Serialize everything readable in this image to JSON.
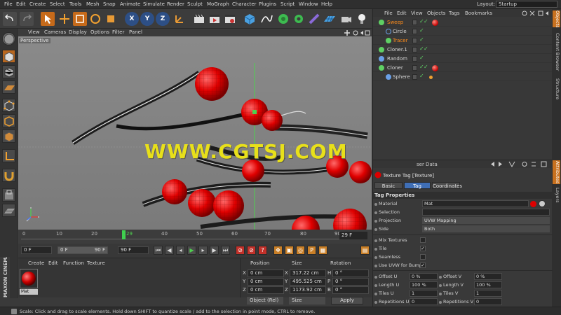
{
  "menubar": {
    "items": [
      "File",
      "Edit",
      "Create",
      "Select",
      "Tools",
      "Mesh",
      "Snap",
      "Animate",
      "Simulate",
      "Render",
      "Sculpt",
      "MoGraph",
      "Character",
      "Plugins",
      "Script",
      "Window",
      "Help"
    ],
    "layout_label": "Layout:",
    "layout_value": "Startup"
  },
  "toolbar": {
    "axis_x": "X",
    "axis_y": "Y",
    "axis_z": "Z"
  },
  "viewport": {
    "menu": [
      "View",
      "Cameras",
      "Display",
      "Options",
      "Filter",
      "Panel"
    ],
    "label": "Perspective",
    "watermark": "WWW.CGTSJ.COM"
  },
  "timeline": {
    "ticks": [
      "0",
      "10",
      "20",
      "30",
      "40",
      "50",
      "60",
      "70",
      "80",
      "90"
    ],
    "current": "29",
    "end_frame": "29 F"
  },
  "transport": {
    "start": "0 F",
    "min": "0 F",
    "max": "90 F",
    "end": "90 F"
  },
  "material_manager": {
    "menu": [
      "Create",
      "Edit",
      "Function",
      "Texture"
    ],
    "material_name": "Mat"
  },
  "maxon_logo": "MAXON CINEMA4D",
  "coordinates": {
    "headers": [
      "Position",
      "Size",
      "Rotation"
    ],
    "rows": [
      {
        "axis": "X",
        "pos": "0 cm",
        "size_axis": "X",
        "size": "317.22 cm",
        "rot_axis": "H",
        "rot": "0 °"
      },
      {
        "axis": "Y",
        "pos": "0 cm",
        "size_axis": "Y",
        "size": "495.525 cm",
        "rot_axis": "P",
        "rot": "0 °"
      },
      {
        "axis": "Z",
        "pos": "0 cm",
        "size_axis": "Z",
        "size": "1173.92 cm",
        "rot_axis": "B",
        "rot": "0 °"
      }
    ],
    "mode": "Object (Rel)",
    "size_mode": "Size",
    "apply": "Apply"
  },
  "status": "Scale: Click and drag to scale elements. Hold down SHIFT to quantize scale / add to the selection in point mode, CTRL to remove.",
  "object_manager": {
    "menu": [
      "File",
      "Edit",
      "View",
      "Objects",
      "Tags",
      "Bookmarks"
    ],
    "objects": [
      {
        "name": "Sweep",
        "color": "#ff8c1a",
        "icon": "#5fd064",
        "indent": 0,
        "tag": true
      },
      {
        "name": "Circle",
        "color": "#d8d8d8",
        "icon": "#6aa0e8",
        "indent": 1,
        "tag": false
      },
      {
        "name": "Tracer",
        "color": "#ff8c1a",
        "icon": "#5fd064",
        "indent": 1,
        "tag": false
      },
      {
        "name": "Cloner.1",
        "color": "#d8d8d8",
        "icon": "#5fd064",
        "indent": 0,
        "tag": false
      },
      {
        "name": "Random",
        "color": "#d8d8d8",
        "icon": "#6aa0e8",
        "indent": 0,
        "tag": false
      },
      {
        "name": "Cloner",
        "color": "#d8d8d8",
        "icon": "#5fd064",
        "indent": 0,
        "tag": true
      },
      {
        "name": "Sphere",
        "color": "#d8d8d8",
        "icon": "#6aa0e8",
        "indent": 1,
        "tag": false
      }
    ]
  },
  "right_tabs": {
    "top": [
      "Objects",
      "Content Browser",
      "Structure"
    ],
    "bottom": [
      "Attributes",
      "Layers"
    ]
  },
  "attribute_manager": {
    "header_fragment": "ser Data",
    "title": "Texture Tag [Texture]",
    "tabs": [
      "Basic",
      "Tag",
      "Coordinates"
    ],
    "section": "Tag Properties",
    "material_label": "Material",
    "material_value": "Mat",
    "selection_label": "Selection",
    "projection_label": "Projection",
    "projection_value": "UVW Mapping",
    "side_label": "Side",
    "side_value": "Both",
    "mix_textures_label": "Mix Textures",
    "tile_label": "Tile",
    "seamless_label": "Seamless",
    "use_uvw_label": "Use UVW for Bump",
    "offset_u_label": "Offset U",
    "offset_u_value": "0 %",
    "offset_v_label": "Offset V",
    "offset_v_value": "0 %",
    "length_u_label": "Length U",
    "length_u_value": "100 %",
    "length_v_label": "Length V",
    "length_v_value": "100 %",
    "tiles_u_label": "Tiles U",
    "tiles_u_value": "1",
    "tiles_v_label": "Tiles V",
    "tiles_v_value": "1",
    "repetitions_u_label": "Repetitions U",
    "repetitions_u_value": "0",
    "repetitions_v_label": "Repetitions V",
    "repetitions_v_value": "0"
  }
}
